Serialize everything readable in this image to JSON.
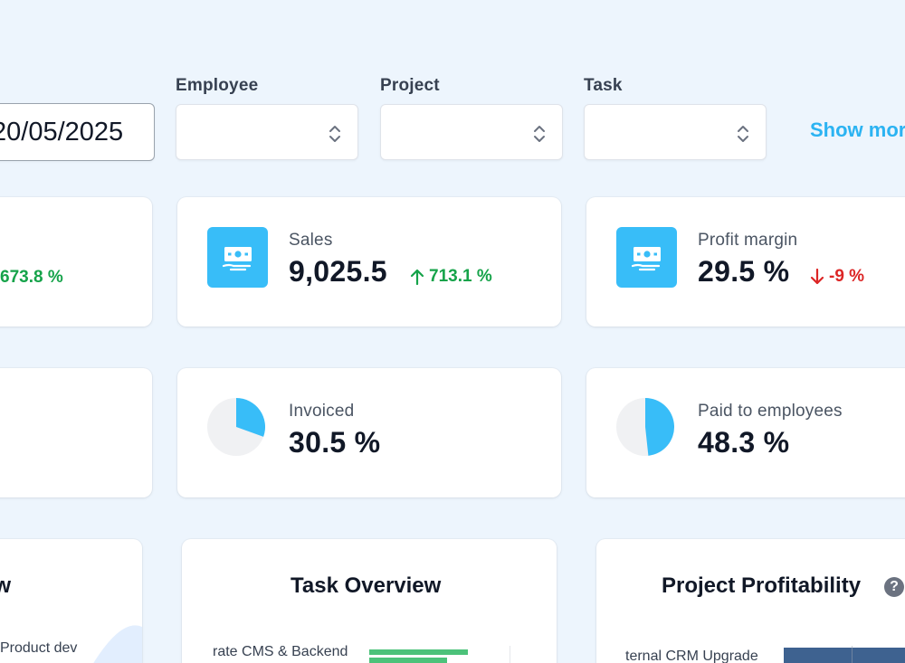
{
  "filters": {
    "date_value": "20/05/2025",
    "employee": {
      "label": "Employee",
      "value": ""
    },
    "project": {
      "label": "Project",
      "value": ""
    },
    "task": {
      "label": "Task",
      "value": ""
    },
    "show_more_label": "Show mor"
  },
  "stats_row1": [
    {
      "title": "",
      "value": "",
      "delta": "673.8 %",
      "direction": "up"
    },
    {
      "title": "Sales",
      "value": "9,025.5",
      "delta": "713.1 %",
      "direction": "up",
      "icon": "money-icon"
    },
    {
      "title": "Profit margin",
      "value": "29.5 %",
      "delta": "-9 %",
      "direction": "down",
      "icon": "money-icon"
    }
  ],
  "stats_row2": [
    {
      "title": "Invoiced",
      "value": "30.5 %",
      "fraction": 0.305
    },
    {
      "title": "Paid to employees",
      "value": "48.3 %",
      "fraction": 0.483
    }
  ],
  "charts": {
    "left": {
      "title": "view",
      "first_label": "Product dev"
    },
    "middle": {
      "title": "Task Overview",
      "first_label": "rate CMS & Backend"
    },
    "right": {
      "title": "Project Profitability",
      "first_label": "ternal CRM Upgrade",
      "help": "?"
    }
  },
  "colors": {
    "accent": "#38bdf8",
    "up": "#16a34a",
    "down": "#dc2626",
    "task_bar": "#4cc27a",
    "profit_bar": "#3e6290",
    "pie_bg": "#f0f1f3"
  }
}
